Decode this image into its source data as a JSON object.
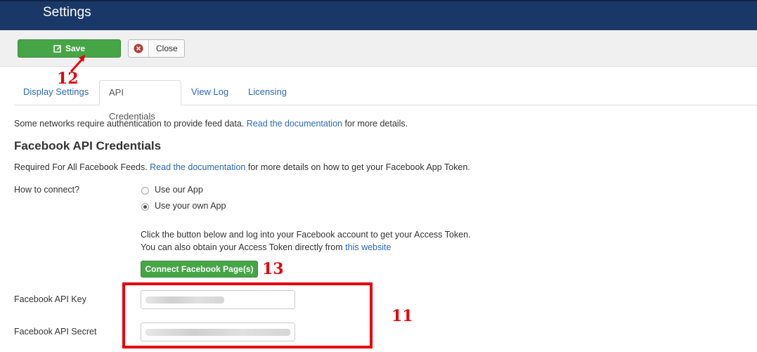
{
  "header": {
    "title": "Settings"
  },
  "toolbar": {
    "save_label": "Save",
    "close_label": "Close"
  },
  "annotations": {
    "a12": "12",
    "a13": "13",
    "a11": "11"
  },
  "tabs": [
    {
      "label": "Display Settings"
    },
    {
      "label": "API Credentials"
    },
    {
      "label": "View Log"
    },
    {
      "label": "Licensing"
    }
  ],
  "intro": {
    "before": "Some networks require authentication to provide feed data. ",
    "link": "Read the documentation",
    "after": " for more details."
  },
  "facebook": {
    "heading": "Facebook API Credentials",
    "required_before": "Required For All Facebook Feeds. ",
    "required_link": "Read the documentation",
    "required_after": " for more details on how to get your Facebook App Token.",
    "connect_label": "How to connect?",
    "options": [
      {
        "label": "Use our App",
        "checked": false
      },
      {
        "label": "Use your own App",
        "checked": true
      }
    ],
    "instruction_line1": "Click the button below and log into your Facebook account to get your Access Token.",
    "instruction_line2_before": "You can also obtain your Access Token directly from ",
    "instruction_line2_link": "this website",
    "connect_button": "Connect Facebook Page(s)",
    "api_key_label": "Facebook API Key",
    "api_secret_label": "Facebook API Secret"
  },
  "colors": {
    "header_bg": "#1a3867",
    "primary_green": "#46a546",
    "link_blue": "#2a69b8",
    "annotation_red": "#e8000b"
  }
}
